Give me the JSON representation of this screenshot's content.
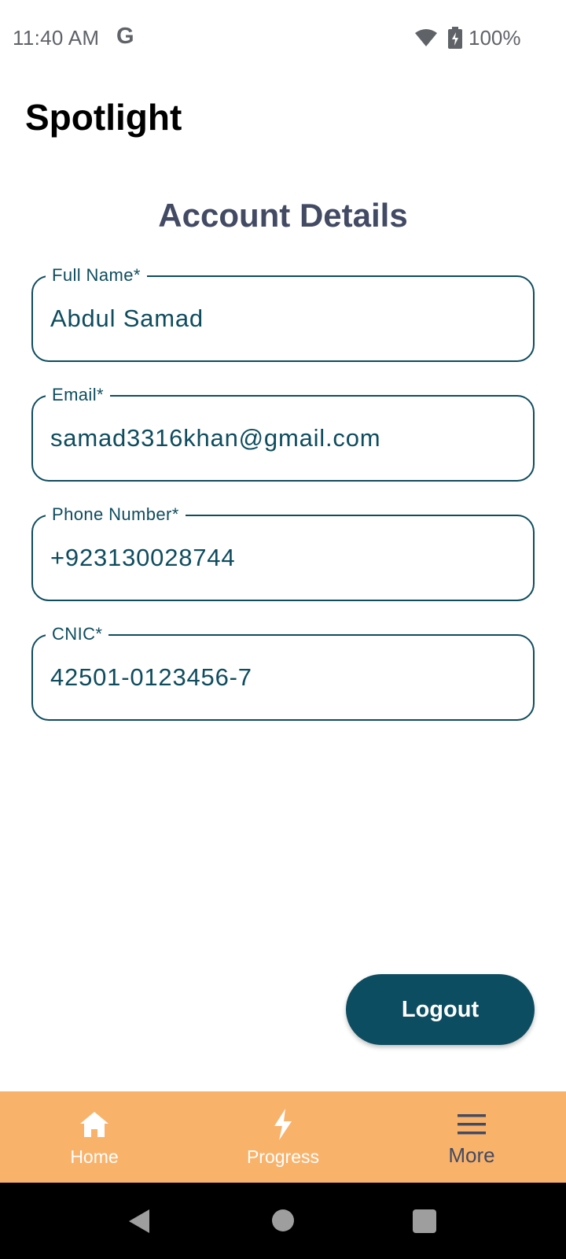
{
  "status_bar": {
    "time": "11:40 AM",
    "google_glyph": "G",
    "wifi_icon": "wifi-icon",
    "battery_icon": "battery-charging-icon",
    "battery_text": "100%"
  },
  "app": {
    "title": "Spotlight"
  },
  "account": {
    "heading": "Account Details",
    "fields": [
      {
        "label": "Full Name*",
        "value": "Abdul Samad"
      },
      {
        "label": "Email*",
        "value": "samad3316khan@gmail.com"
      },
      {
        "label": "Phone Number*",
        "value": "+923130028744"
      },
      {
        "label": "CNIC*",
        "value": "42501-0123456-7"
      }
    ],
    "logout_label": "Logout"
  },
  "bottom_nav": {
    "items": [
      {
        "label": "Home",
        "icon": "home-icon"
      },
      {
        "label": "Progress",
        "icon": "bolt-icon"
      },
      {
        "label": "More",
        "icon": "menu-icon",
        "selected": true
      }
    ]
  },
  "colors": {
    "primary": "#0d4d61",
    "heading": "#424a64",
    "nav_background": "#f9b26a",
    "field_text": "#0e4c5e"
  }
}
